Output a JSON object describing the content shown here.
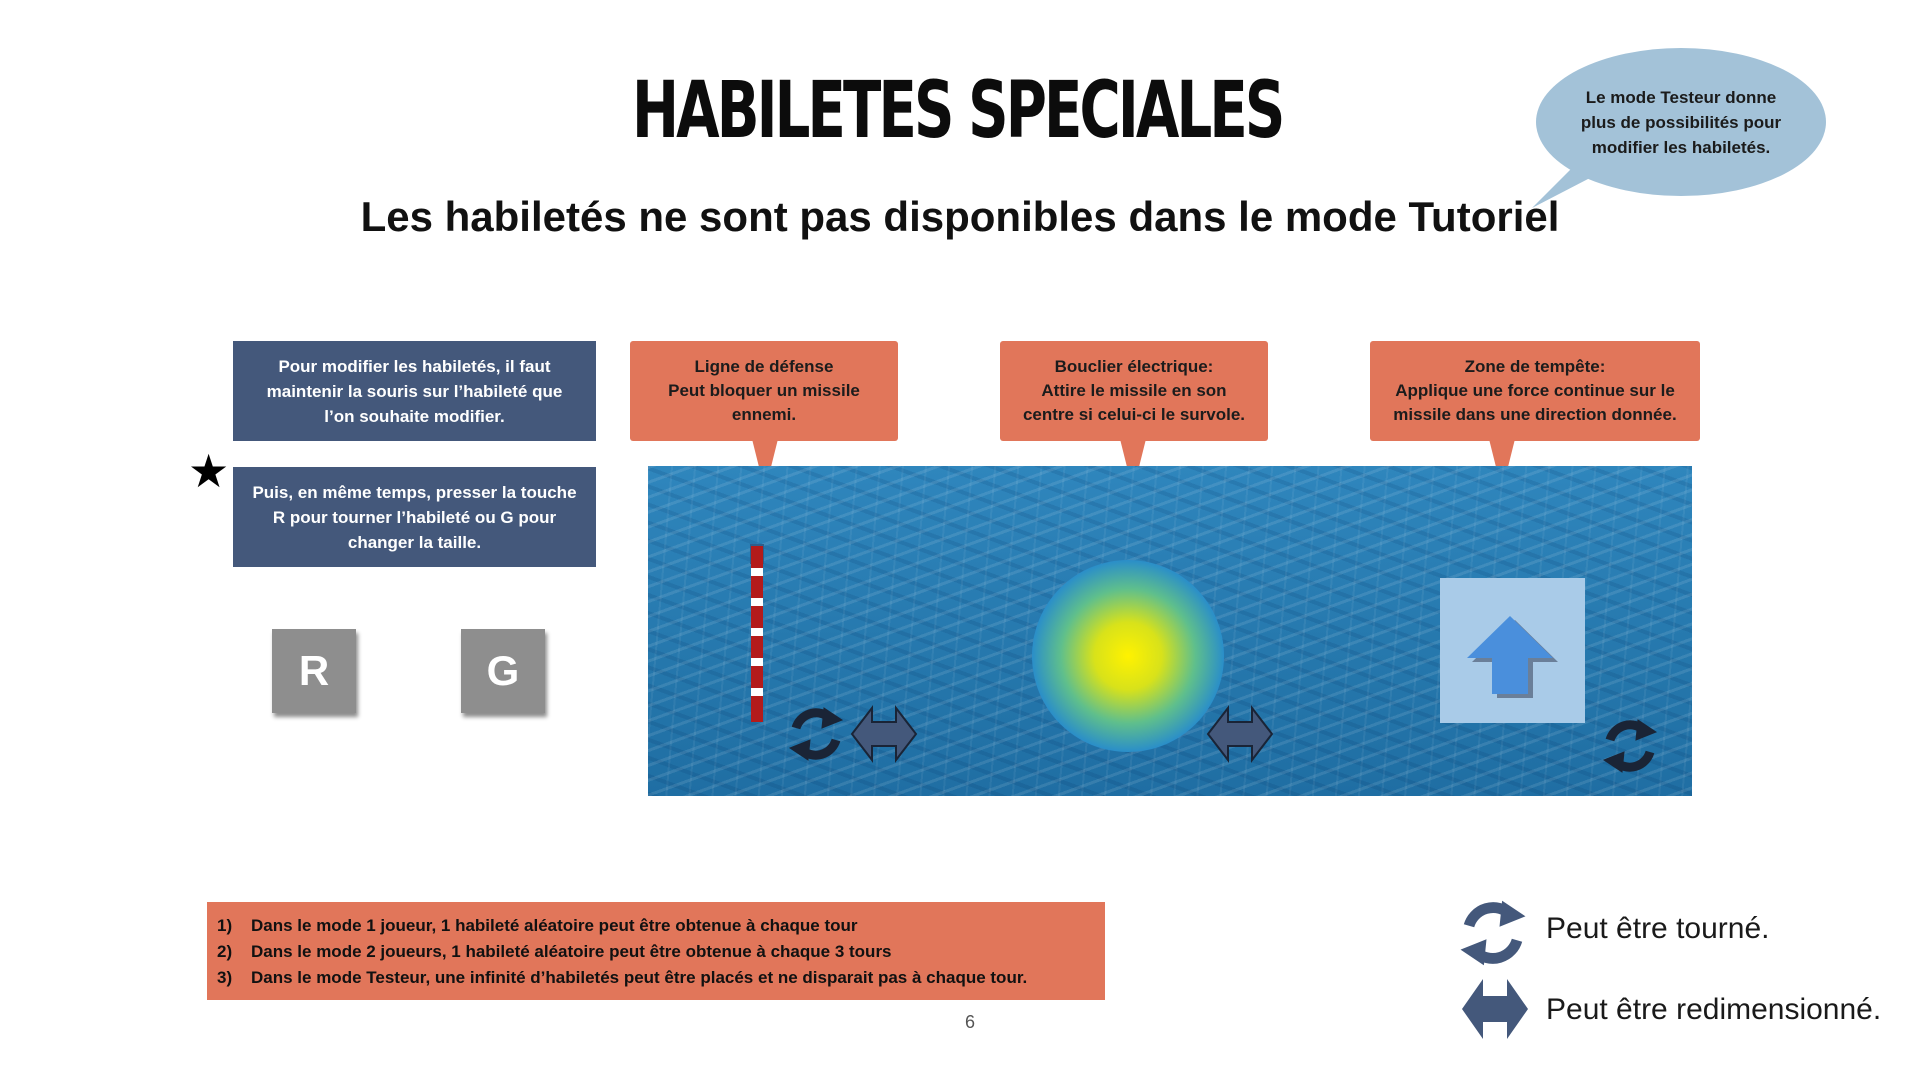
{
  "title": "HABILETES SPECIALES",
  "subtitle": "Les habiletés ne sont pas disponibles dans le mode Tutoriel",
  "bubble": "Le mode Testeur donne\nplus de possibilités pour\nmodifier les habiletés.",
  "instructions": {
    "step1": "Pour modifier les habiletés, il faut\nmaintenir la souris sur l’habileté que\nl’on souhaite modifier.",
    "step2": "Puis, en même temps, presser la touche\nR pour tourner l’habileté ou G pour\nchanger la taille.",
    "star": "★"
  },
  "keys": {
    "r": "R",
    "g": "G"
  },
  "abilities": [
    {
      "text": "Ligne de défense\nPeut bloquer un missile\nennemi."
    },
    {
      "text": "Bouclier électrique:\nAttire le missile en son\ncentre si celui-ci le survole."
    },
    {
      "text": "Zone de tempête:\nApplique une force continue sur le\nmissile dans une direction donnée."
    }
  ],
  "rules": [
    {
      "num": "1)",
      "text": "Dans le mode 1 joueur, 1 habileté aléatoire peut être obtenue à chaque tour"
    },
    {
      "num": "2)",
      "text": "Dans le mode 2 joueurs, 1 habileté aléatoire peut être obtenue à chaque  3 tours"
    },
    {
      "num": "3)",
      "text": "Dans le mode Testeur, une infinité d’habiletés peut être placés et ne disparait pas à chaque tour."
    }
  ],
  "legend": {
    "rotate": "Peut être tourné.",
    "resize": "Peut être redimensionné."
  },
  "page_number": "6",
  "colors": {
    "instruction_box": "#44587b",
    "callout": "#e1765a",
    "bubble": "#a3c2d8",
    "key": "#8e8e8e",
    "icon": "#44587b",
    "ocean": "#2577ac"
  },
  "icons": {
    "rotate": "rotate-arrows-icon",
    "resize": "double-arrow-icon",
    "wind": "up-arrow-icon",
    "star": "star-icon"
  }
}
